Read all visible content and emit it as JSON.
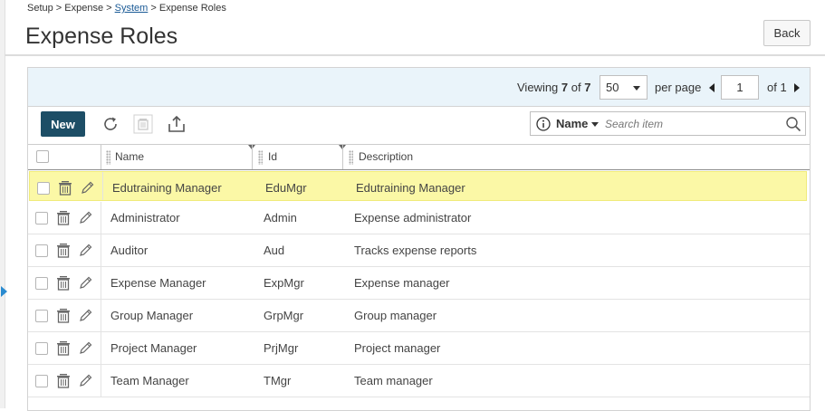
{
  "breadcrumb": {
    "part1": "Setup > Expense > ",
    "link": "System",
    "part2": " > Expense Roles"
  },
  "page_title": "Expense Roles",
  "back_label": "Back",
  "pager": {
    "viewing_prefix": "Viewing ",
    "viewing_count": "7",
    "viewing_of": " of ",
    "viewing_total": "7",
    "per_page_value": "50",
    "per_page_label": "per page",
    "page_value": "1",
    "of_pages": "of 1"
  },
  "toolbar": {
    "new_label": "New",
    "icons": [
      "refresh-icon",
      "trash-icon",
      "export-icon"
    ]
  },
  "search": {
    "field": "Name",
    "placeholder": "Search item"
  },
  "columns": [
    "Name",
    "Id",
    "Description"
  ],
  "rows": [
    {
      "name": "Edutraining Manager",
      "id": "EduMgr",
      "description": "Edutraining Manager",
      "highlighted": true
    },
    {
      "name": "Administrator",
      "id": "Admin",
      "description": "Expense administrator"
    },
    {
      "name": "Auditor",
      "id": "Aud",
      "description": "Tracks expense reports"
    },
    {
      "name": "Expense Manager",
      "id": "ExpMgr",
      "description": "Expense manager"
    },
    {
      "name": "Group Manager",
      "id": "GrpMgr",
      "description": "Group manager"
    },
    {
      "name": "Project Manager",
      "id": "PrjMgr",
      "description": "Project manager"
    },
    {
      "name": "Team Manager",
      "id": "TMgr",
      "description": "Team manager"
    }
  ],
  "colors": {
    "new_button": "#1d4e66",
    "highlight_row": "#fbf8a6",
    "pager_background": "#eaf4fa",
    "link": "#1a5a96"
  }
}
